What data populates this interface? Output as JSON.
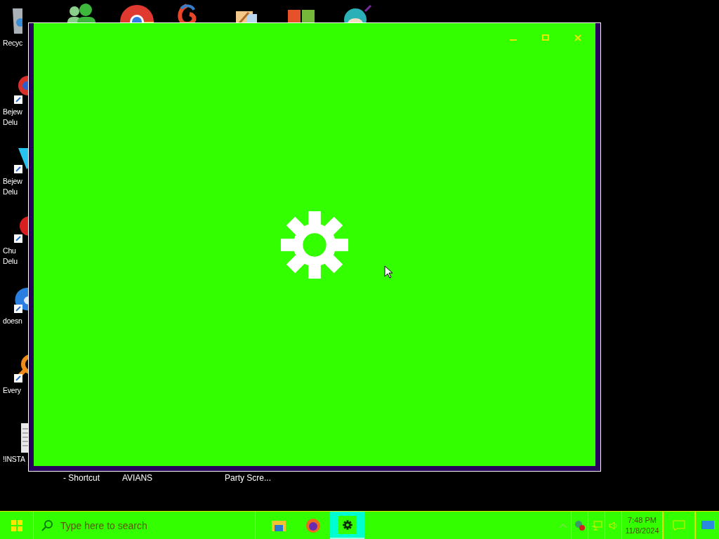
{
  "desktop": {
    "left_icons": [
      {
        "kind": "bin",
        "label_lines": [
          "Recyc"
        ]
      },
      {
        "kind": "ball",
        "label_lines": [
          "Bejew",
          "Delu"
        ]
      },
      {
        "kind": "gem",
        "label_lines": [
          "Bejew",
          "Delu"
        ]
      },
      {
        "kind": "blob",
        "label_lines": [
          "Chu",
          "Delu"
        ]
      },
      {
        "kind": "bird",
        "label_lines": [
          "doesn"
        ]
      },
      {
        "kind": "ring",
        "label_lines": [
          "Every"
        ]
      },
      {
        "kind": "doc",
        "label_lines": [
          "!INSTA"
        ]
      }
    ],
    "bottom_labels": [
      "- Shortcut",
      "AVIANS",
      "Party Scre..."
    ]
  },
  "window": {
    "loading": true
  },
  "taskbar": {
    "search": {
      "placeholder": "Type here to search"
    },
    "apps": [
      {
        "kind": "folder",
        "selected": false
      },
      {
        "kind": "browser",
        "selected": false
      },
      {
        "kind": "gear",
        "selected": true
      }
    ],
    "clock": {
      "time": "7:48 PM",
      "date": "11/8/2024"
    }
  }
}
